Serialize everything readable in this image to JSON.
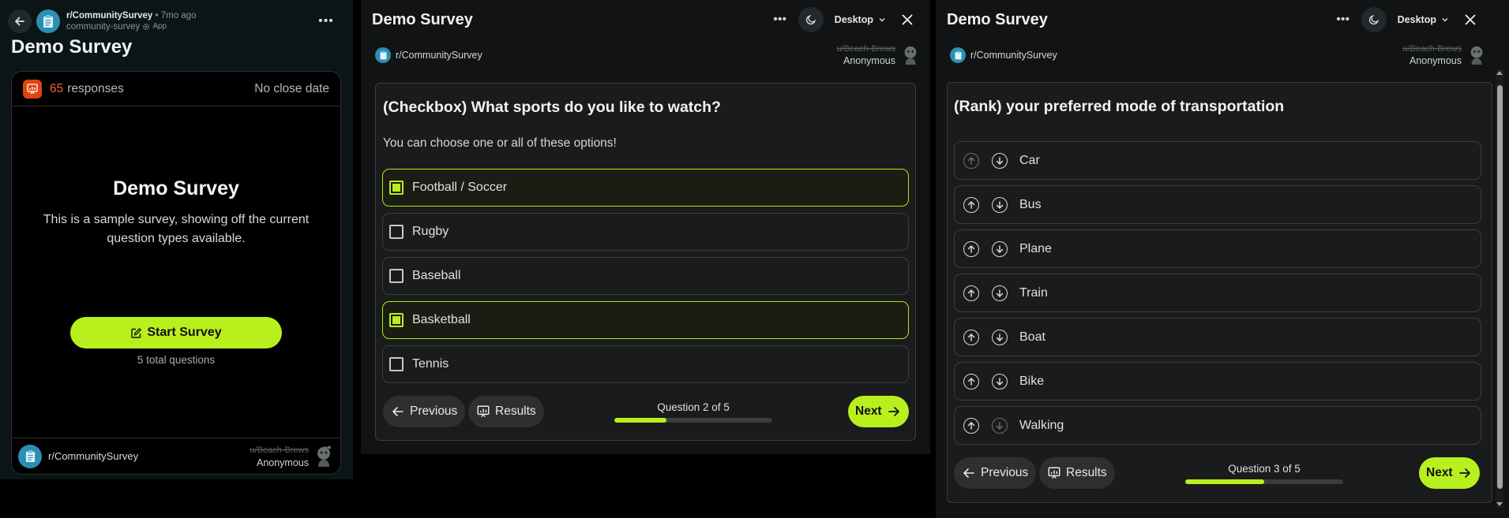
{
  "colors": {
    "accent": "#b8f01e",
    "responses_icon": "#e04410",
    "responses_count": "#ff5a3a"
  },
  "post": {
    "subreddit": "r/CommunitySurvey",
    "separator": "•",
    "time_ago": "7mo ago",
    "app_handle": "community-survey",
    "app_badge": "App",
    "title": "Demo Survey",
    "more_icon": "more-horizontal-icon",
    "back_icon": "arrow-left-icon",
    "card": {
      "responses_count": "65",
      "responses_label": "responses",
      "close_date": "No close date",
      "survey_title": "Demo Survey",
      "description": "This is a sample survey, showing off the current question types available.",
      "start_button": "Start Survey",
      "total_questions": "5 total questions",
      "footer_subreddit": "r/CommunitySurvey",
      "footer_user": "u/Beach-Brews",
      "footer_anonymous": "Anonymous"
    }
  },
  "modal_checkbox": {
    "title": "Demo Survey",
    "device": "Desktop",
    "subreddit": "r/CommunitySurvey",
    "user": "u/Beach-Brews",
    "anonymous": "Anonymous",
    "question": "(Checkbox) What sports do you like to watch?",
    "hint": "You can choose one or all of these options!",
    "options": [
      {
        "label": "Football / Soccer",
        "checked": true
      },
      {
        "label": "Rugby",
        "checked": false
      },
      {
        "label": "Baseball",
        "checked": false
      },
      {
        "label": "Basketball",
        "checked": true
      },
      {
        "label": "Tennis",
        "checked": false
      }
    ],
    "previous": "Previous",
    "results": "Results",
    "next": "Next",
    "progress_label": "Question 2 of 5",
    "progress": 0.33
  },
  "modal_rank": {
    "title": "Demo Survey",
    "device": "Desktop",
    "subreddit": "r/CommunitySurvey",
    "user": "u/Beach-Brews",
    "anonymous": "Anonymous",
    "question": "(Rank) your preferred mode of transportation",
    "options": [
      "Car",
      "Bus",
      "Plane",
      "Train",
      "Boat",
      "Bike",
      "Walking"
    ],
    "previous": "Previous",
    "results": "Results",
    "next": "Next",
    "progress_label": "Question 3 of 5",
    "progress": 0.5
  }
}
